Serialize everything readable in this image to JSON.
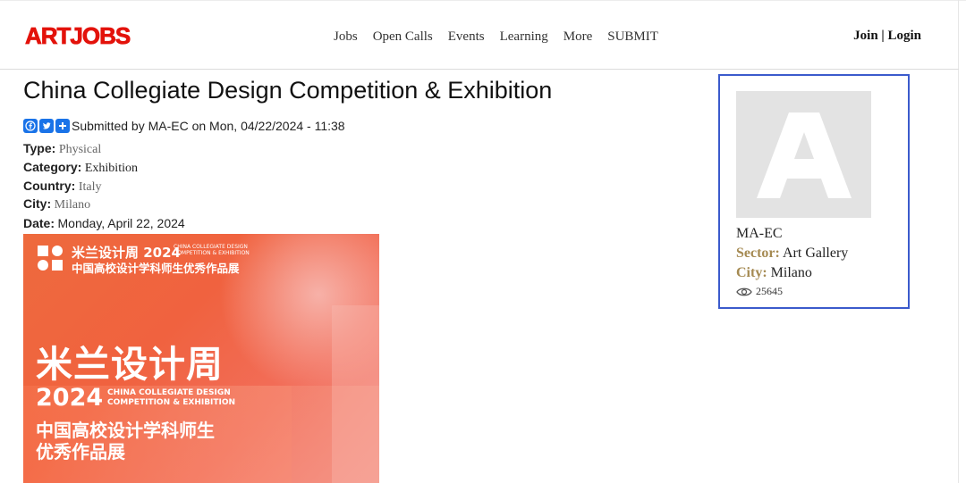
{
  "header": {
    "logo": "ARTJOBS",
    "nav": [
      "Jobs",
      "Open Calls",
      "Events",
      "Learning",
      "More",
      "SUBMIT"
    ],
    "join": "Join",
    "separator": "|",
    "login": "Login"
  },
  "article": {
    "title": "China Collegiate Design Competition & Exhibition",
    "submitted": "Submitted by MA-EC on Mon, 04/22/2024 - 11:38",
    "share_icons": [
      "facebook-icon",
      "twitter-icon",
      "share-plus-icon"
    ],
    "fields": {
      "type_label": "Type:",
      "type_value": "Physical",
      "category_label": "Category:",
      "category_value": "Exhibition",
      "country_label": "Country:",
      "country_value": "Italy",
      "city_label": "City:",
      "city_value": "Milano",
      "date_label": "Date:",
      "date_value": "Monday, April 22, 2024"
    },
    "poster": {
      "top_line": "米兰设计周 2024",
      "top_en1": "CHINA COLLEGIATE DESIGN",
      "top_en2": "COMPETITION & EXHIBITION",
      "top_cn": "中国高校设计学科师生优秀作品展",
      "big_cn": "米兰设计周",
      "year": "2024",
      "en1": "CHINA COLLEGIATE DESIGN",
      "en2": "COMPETITION & EXHIBITION",
      "cn1": "中国高校设计学科师生",
      "cn2": "优秀作品展"
    }
  },
  "sidebar": {
    "name": "MA-EC",
    "sector_label": "Sector:",
    "sector_value": "Art Gallery",
    "city_label": "City:",
    "city_value": "Milano",
    "views": "25645",
    "avatar_letter": "A"
  },
  "colors": {
    "brand": "#e3120b",
    "sidebar_border": "#3b5bcc",
    "sidebar_label": "#a58a52",
    "share_blue": "#1a73e8"
  }
}
